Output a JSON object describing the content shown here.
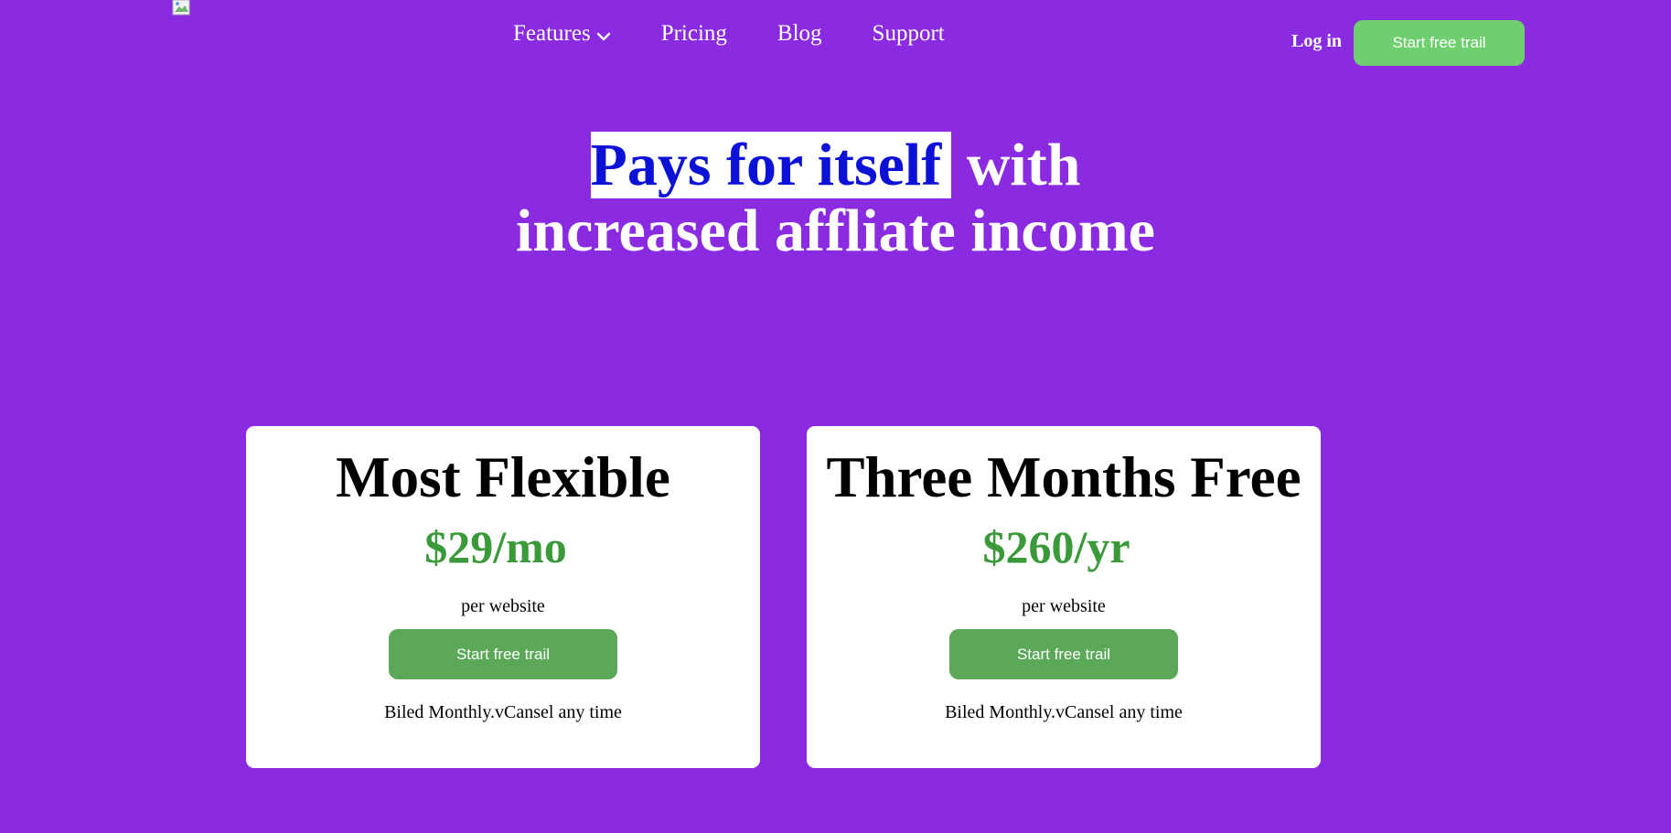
{
  "header": {
    "nav": [
      {
        "label": "Features",
        "has_dropdown": true
      },
      {
        "label": "Pricing"
      },
      {
        "label": "Blog"
      },
      {
        "label": "Support"
      }
    ],
    "login_label": "Log in",
    "cta_label": "Start free trail"
  },
  "hero": {
    "highlight": "Pays for itself",
    "line1_rest": "with",
    "line2": "increased affliate income"
  },
  "plans": [
    {
      "title": "Most Flexible",
      "price": "$29/mo",
      "per": "per website",
      "button": "Start free trail",
      "note": "Biled Monthly.vCansel any time"
    },
    {
      "title": "Three Months Free",
      "price": "$260/yr",
      "per": "per website",
      "button": "Start free trail",
      "note": "Biled Monthly.vCansel any time"
    }
  ],
  "colors": {
    "background": "#8a2be2",
    "highlight_text": "#0b11d6",
    "price": "#3a9a3a",
    "button": "#5aa858",
    "header_button": "#6fcf6f"
  },
  "icons": {
    "logo": "broken-image-icon",
    "dropdown": "chevron-down-icon"
  }
}
